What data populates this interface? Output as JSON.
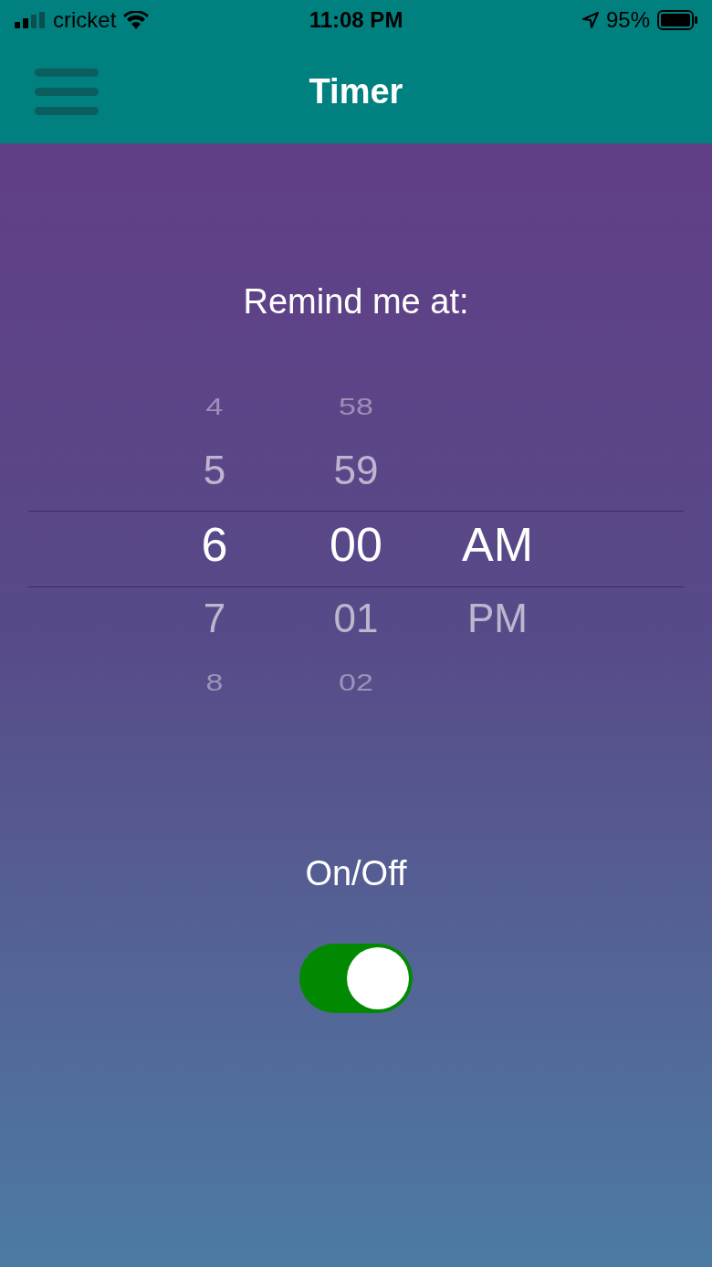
{
  "status_bar": {
    "carrier": "cricket",
    "time": "11:08 PM",
    "battery": "95%"
  },
  "header": {
    "title": "Timer"
  },
  "prompt": "Remind me at:",
  "picker": {
    "columns": [
      {
        "items": [
          {
            "label": "4",
            "selected": false
          },
          {
            "label": "5",
            "selected": false
          },
          {
            "label": "6",
            "selected": true
          },
          {
            "label": "7",
            "selected": false
          },
          {
            "label": "8",
            "selected": false
          }
        ]
      },
      {
        "items": [
          {
            "label": "58",
            "selected": false
          },
          {
            "label": "59",
            "selected": false
          },
          {
            "label": "00",
            "selected": true
          },
          {
            "label": "01",
            "selected": false
          },
          {
            "label": "02",
            "selected": false
          }
        ]
      },
      {
        "items": [
          {
            "label": "AM",
            "selected": true
          },
          {
            "label": "PM",
            "selected": false
          }
        ]
      }
    ]
  },
  "toggle": {
    "label": "On/Off",
    "on": true
  }
}
